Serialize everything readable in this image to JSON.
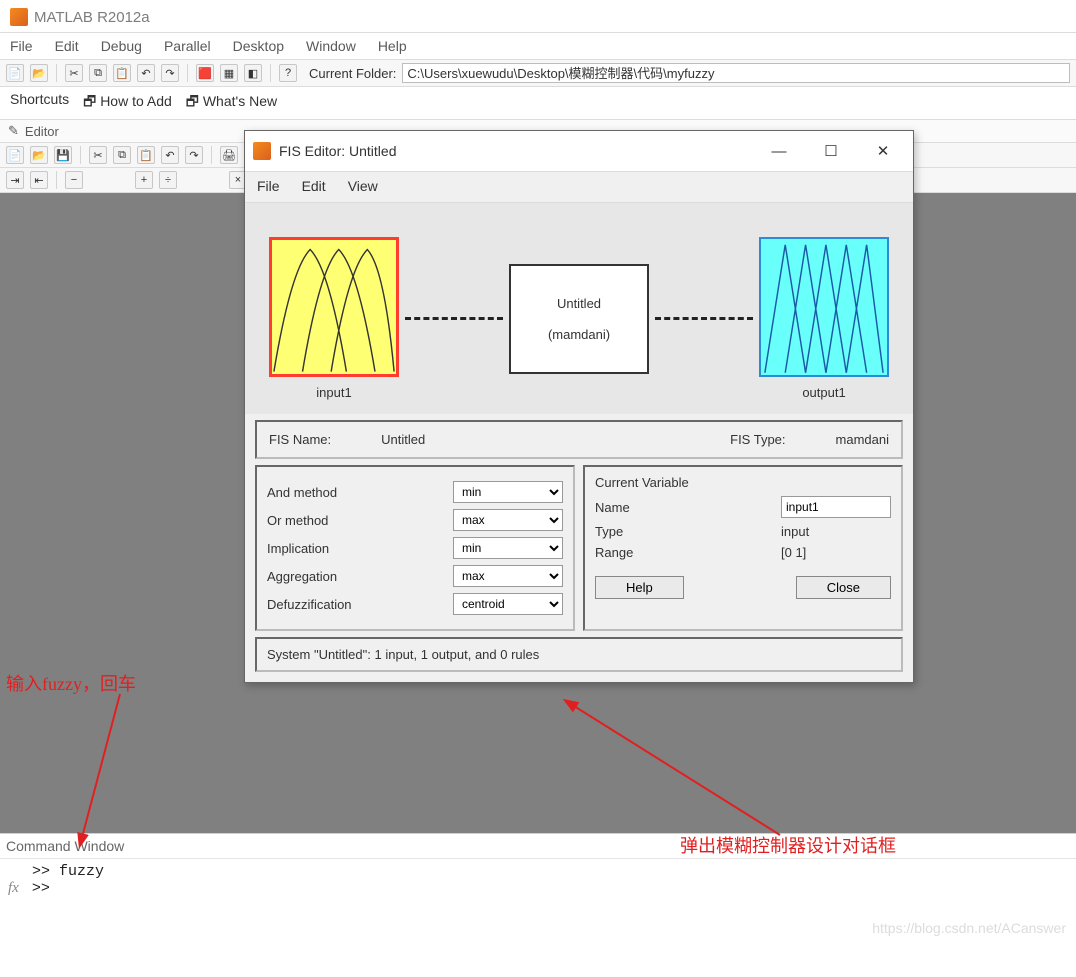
{
  "app_title": "MATLAB R2012a",
  "main_menu": [
    "File",
    "Edit",
    "Debug",
    "Parallel",
    "Desktop",
    "Window",
    "Help"
  ],
  "toolbar": {
    "current_folder_label": "Current Folder:",
    "current_folder_path": "C:\\Users\\xuewudu\\Desktop\\模糊控制器\\代码\\myfuzzy"
  },
  "shortcuts": {
    "label": "Shortcuts",
    "how_to_add": "How to Add",
    "whats_new": "What's New"
  },
  "editor_title": "Editor",
  "command_window": {
    "title": "Command Window",
    "line1_prompt": ">>",
    "line1_cmd": "fuzzy",
    "line2_fx": "fx",
    "line2_prompt": ">>"
  },
  "fis": {
    "title": "FIS Editor: Untitled",
    "menu": [
      "File",
      "Edit",
      "View"
    ],
    "input_label": "input1",
    "output_label": "output1",
    "system_name": "Untitled",
    "system_type_paren": "(mamdani)",
    "info": {
      "fis_name_label": "FIS Name:",
      "fis_name_value": "Untitled",
      "fis_type_label": "FIS Type:",
      "fis_type_value": "mamdani"
    },
    "left_panel": {
      "and_label": "And method",
      "and_value": "min",
      "or_label": "Or method",
      "or_value": "max",
      "imp_label": "Implication",
      "imp_value": "min",
      "agg_label": "Aggregation",
      "agg_value": "max",
      "def_label": "Defuzzification",
      "def_value": "centroid"
    },
    "right_panel": {
      "header": "Current Variable",
      "name_label": "Name",
      "name_value": "input1",
      "type_label": "Type",
      "type_value": "input",
      "range_label": "Range",
      "range_value": "[0 1]",
      "help_btn": "Help",
      "close_btn": "Close"
    },
    "status": "System \"Untitled\": 1 input, 1 output, and 0 rules"
  },
  "annotations": {
    "left": "输入fuzzy，回车",
    "right": "弹出模糊控制器设计对话框"
  },
  "watermark": "https://blog.csdn.net/ACanswer"
}
